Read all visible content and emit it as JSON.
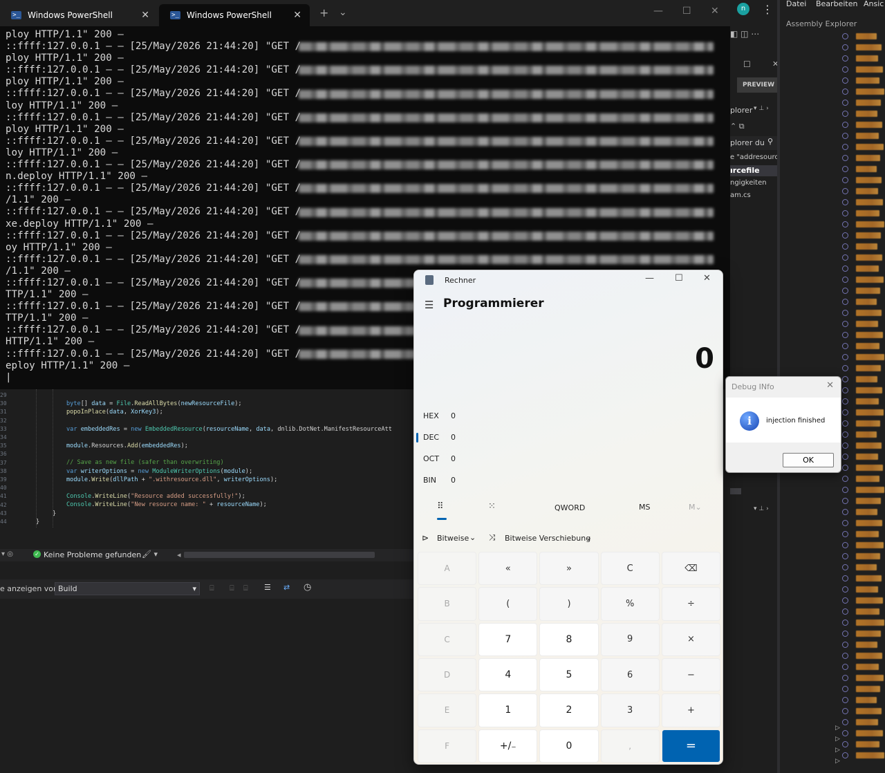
{
  "powershell": {
    "tabs": [
      {
        "label": "Windows PowerShell"
      },
      {
        "label": "Windows PowerShell"
      }
    ],
    "new_tab": "+",
    "dropdown": "⌄",
    "lines": [
      "ploy HTTP/1.1\" 200 –",
      "::ffff:127.0.0.1 – – [25/May/2026 21:44:20] \"GET /",
      "ploy HTTP/1.1\" 200 –",
      "::ffff:127.0.0.1 – – [25/May/2026 21:44:20] \"GET /",
      "ploy HTTP/1.1\" 200 –",
      "::ffff:127.0.0.1 – – [25/May/2026 21:44:20] \"GET /",
      "loy HTTP/1.1\" 200 –",
      "::ffff:127.0.0.1 – – [25/May/2026 21:44:20] \"GET /",
      "ploy HTTP/1.1\" 200 –",
      "::ffff:127.0.0.1 – – [25/May/2026 21:44:20] \"GET /",
      "loy HTTP/1.1\" 200 –",
      "::ffff:127.0.0.1 – – [25/May/2026 21:44:20] \"GET /",
      "n.deploy HTTP/1.1\" 200 –",
      "::ffff:127.0.0.1 – – [25/May/2026 21:44:20] \"GET /",
      "/1.1\" 200 –",
      "::ffff:127.0.0.1 – – [25/May/2026 21:44:20] \"GET /",
      "xe.deploy HTTP/1.1\" 200 –",
      "::ffff:127.0.0.1 – – [25/May/2026 21:44:20] \"GET /",
      "oy HTTP/1.1\" 200 –",
      "::ffff:127.0.0.1 – – [25/May/2026 21:44:20] \"GET /",
      "/1.1\" 200 –",
      "::ffff:127.0.0.1 – – [25/May/2026 21:44:20] \"GET /",
      "TTP/1.1\" 200 –",
      "::ffff:127.0.0.1 – – [25/May/2026 21:44:20] \"GET /",
      "TTP/1.1\" 200 –",
      "::ffff:127.0.0.1 – – [25/May/2026 21:44:20] \"GET /",
      "HTTP/1.1\" 200 –",
      "::ffff:127.0.0.1 – – [25/May/2026 21:44:20] \"GET /",
      "eploy HTTP/1.1\" 200 –",
      "|"
    ]
  },
  "editor": {
    "line_numbers": [
      "29",
      "30",
      "31",
      "32",
      "33",
      "34",
      "35",
      "36",
      "37",
      "38",
      "39",
      "40",
      "41",
      "42",
      "43",
      "44"
    ],
    "code": [
      {
        "parts": [
          [
            "kw",
            "byte"
          ],
          [
            "",
            "[] "
          ],
          [
            "vr",
            "data"
          ],
          [
            "",
            " = "
          ],
          [
            "ty",
            "File"
          ],
          [
            "",
            "."
          ],
          [
            "fn",
            "ReadAllBytes"
          ],
          [
            "",
            "("
          ],
          [
            "vr",
            "newResourceFile"
          ],
          [
            "",
            ");"
          ]
        ]
      },
      {
        "parts": [
          [
            "fn",
            "popoInPlace"
          ],
          [
            "",
            "("
          ],
          [
            "vr",
            "data"
          ],
          [
            "",
            ", "
          ],
          [
            "vr",
            "XorKey3"
          ],
          [
            "",
            ");"
          ]
        ]
      },
      {
        "parts": []
      },
      {
        "parts": [
          [
            "kw",
            "var"
          ],
          [
            "",
            " "
          ],
          [
            "vr",
            "embeddedRes"
          ],
          [
            "",
            " = "
          ],
          [
            "kw",
            "new"
          ],
          [
            "",
            " "
          ],
          [
            "ty",
            "EmbeddedResource"
          ],
          [
            "",
            "("
          ],
          [
            "vr",
            "resourceName"
          ],
          [
            "",
            ", "
          ],
          [
            "vr",
            "data"
          ],
          [
            "",
            ", dnlib.DotNet.ManifestResourceAtt"
          ]
        ]
      },
      {
        "parts": []
      },
      {
        "parts": [
          [
            "vr",
            "module"
          ],
          [
            "",
            ".Resources."
          ],
          [
            "fn",
            "Add"
          ],
          [
            "",
            "("
          ],
          [
            "vr",
            "embeddedRes"
          ],
          [
            "",
            ");"
          ]
        ]
      },
      {
        "parts": []
      },
      {
        "parts": [
          [
            "cm",
            "// Save as new file (safer than overwriting)"
          ]
        ]
      },
      {
        "parts": [
          [
            "kw",
            "var"
          ],
          [
            "",
            " "
          ],
          [
            "vr",
            "writerOptions"
          ],
          [
            "",
            " = "
          ],
          [
            "kw",
            "new"
          ],
          [
            "",
            " "
          ],
          [
            "ty",
            "ModuleWriterOptions"
          ],
          [
            "",
            "("
          ],
          [
            "vr",
            "module"
          ],
          [
            "",
            ");"
          ]
        ]
      },
      {
        "parts": [
          [
            "vr",
            "module"
          ],
          [
            "",
            "."
          ],
          [
            "fn",
            "Write"
          ],
          [
            "",
            "("
          ],
          [
            "vr",
            "dllPath"
          ],
          [
            "",
            " + "
          ],
          [
            "st",
            "\".withresource.dll\""
          ],
          [
            "",
            ", "
          ],
          [
            "vr",
            "writerOptions"
          ],
          [
            "",
            ");"
          ]
        ]
      },
      {
        "parts": []
      },
      {
        "parts": [
          [
            "ty",
            "Console"
          ],
          [
            "",
            "."
          ],
          [
            "fn",
            "WriteLine"
          ],
          [
            "",
            "("
          ],
          [
            "st",
            "\"Resource added successfully!\""
          ],
          [
            "",
            ");"
          ]
        ]
      },
      {
        "parts": [
          [
            "ty",
            "Console"
          ],
          [
            "",
            "."
          ],
          [
            "fn",
            "WriteLine"
          ],
          [
            "",
            "("
          ],
          [
            "st",
            "\"New resource name: \""
          ],
          [
            "",
            " + "
          ],
          [
            "vr",
            "resourceName"
          ],
          [
            "",
            ");"
          ]
        ]
      },
      {
        "parts": [
          [
            "",
            "}"
          ]
        ]
      },
      {
        "parts": [
          [
            "",
            "}"
          ]
        ]
      },
      {
        "parts": []
      }
    ],
    "status_text": "Keine Probleme gefunden",
    "output_label": "e anzeigen von:",
    "output_source": "Build"
  },
  "vs": {
    "menu": [
      "Datei",
      "Bearbeiten",
      "Ansic"
    ],
    "assembly_explorer": "Assembly Explorer",
    "preview": "PREVIEW",
    "panel_labels": [
      "plorer",
      "plorer du",
      "e \"addresourc",
      "ırcefile",
      "ngigkeiten",
      "am.cs"
    ]
  },
  "calculator": {
    "title": "Rechner",
    "mode": "Programmierer",
    "display": "0",
    "radix": [
      {
        "name": "HEX",
        "value": "0"
      },
      {
        "name": "DEC",
        "value": "0"
      },
      {
        "name": "OCT",
        "value": "0"
      },
      {
        "name": "BIN",
        "value": "0"
      }
    ],
    "word_size": "QWORD",
    "memory_store": "MS",
    "memory_menu": "M⌄",
    "bitwise": "Bitweise",
    "bit_shift": "Bitweise Verschiebung",
    "keys": [
      [
        "A",
        "«",
        "»",
        "C",
        "⌫"
      ],
      [
        "B",
        "(",
        ")",
        "%",
        "÷"
      ],
      [
        "C",
        "7",
        "8",
        "9",
        "×"
      ],
      [
        "D",
        "4",
        "5",
        "6",
        "−"
      ],
      [
        "E",
        "1",
        "2",
        "3",
        "+"
      ],
      [
        "F",
        "+/₋",
        "0",
        ",",
        "="
      ]
    ]
  },
  "debug_dialog": {
    "title": "Debug INfo",
    "message": "injection finished",
    "ok": "OK"
  },
  "colors": {
    "accent": "#0063b1",
    "terminal_bg": "#0c0c0c",
    "editor_bg": "#1e1e1e"
  }
}
